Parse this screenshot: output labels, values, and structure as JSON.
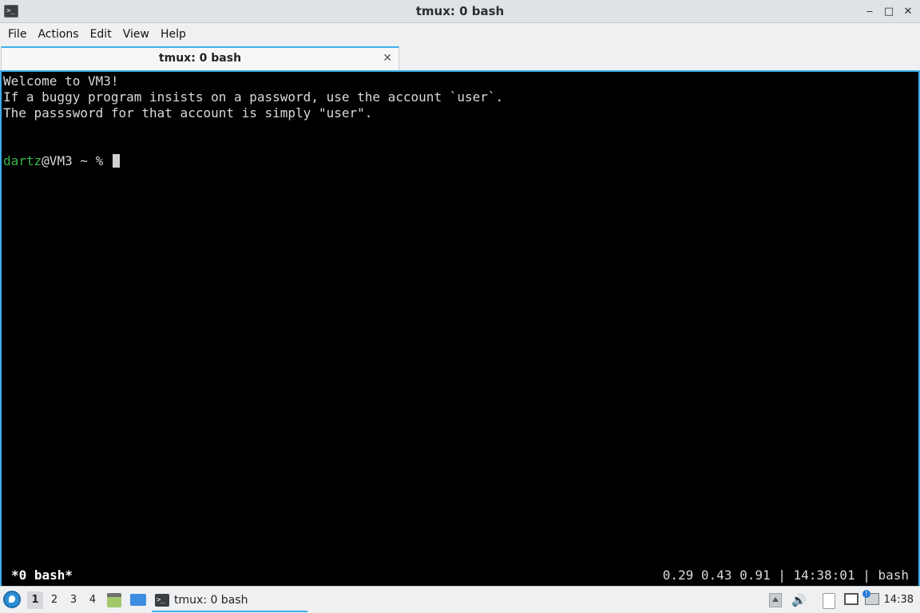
{
  "window": {
    "title": "tmux: 0 bash",
    "icon": "terminal-icon",
    "controls": {
      "minimize": "‒",
      "maximize": "□",
      "close": "✕"
    }
  },
  "menu": {
    "items": [
      "File",
      "Actions",
      "Edit",
      "View",
      "Help"
    ]
  },
  "tab": {
    "label": "tmux: 0 bash",
    "close": "✕"
  },
  "terminal": {
    "lines": [
      "Welcome to VM3!",
      "If a buggy program insists on a password, use the account `user`.",
      "The passsword for that account is simply \"user\"."
    ],
    "prompt_user": "dartz",
    "prompt_rest": "@VM3 ~ % ",
    "status_left": "*0 bash*",
    "status_right": "0.29 0.43 0.91 | 14:38:01 | bash",
    "colors": {
      "background": "#000000",
      "text": "#d9d9d9",
      "prompt_user": "#38b54a"
    }
  },
  "taskbar": {
    "desktops": [
      "1",
      "2",
      "3",
      "4"
    ],
    "active_desktop": "1",
    "task_label": "tmux: 0 bash",
    "clock": "14:38",
    "tray_icons": [
      "show-hidden-icon",
      "volume-icon",
      "clipboard-icon",
      "network-icon",
      "update-notifier-icon"
    ]
  },
  "accent_color": "#3daee9"
}
